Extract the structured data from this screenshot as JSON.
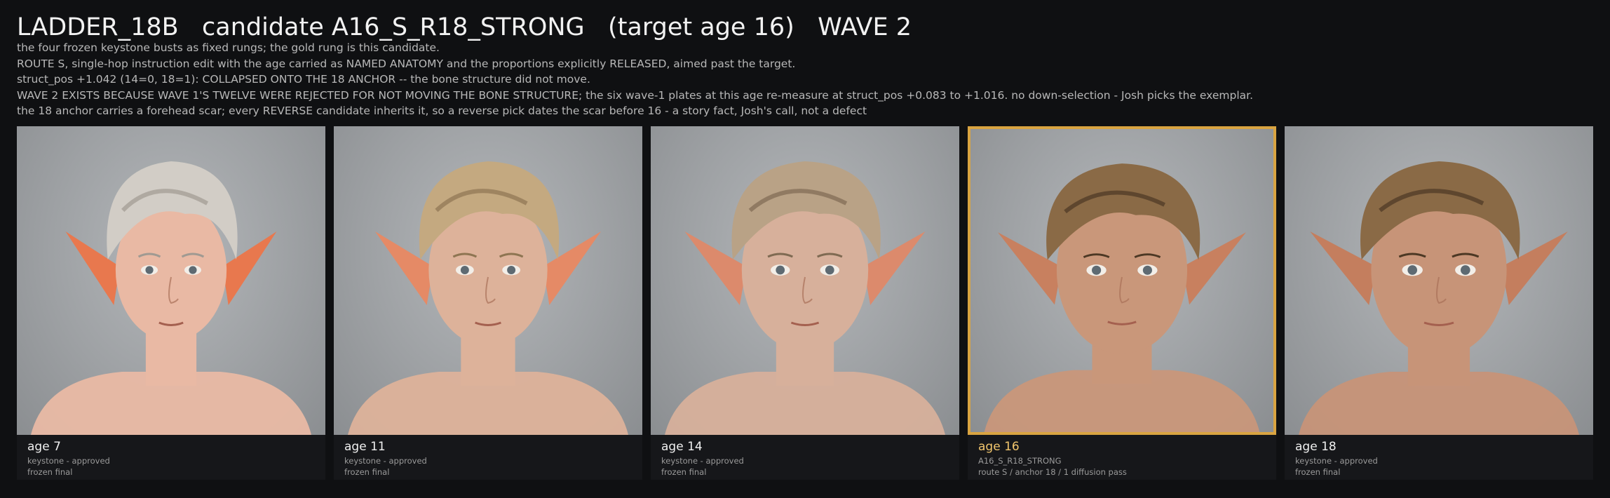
{
  "title": "LADDER_18B   candidate A16_S_R18_STRONG   (target age 16)   WAVE 2",
  "notes": [
    "the four frozen keystone busts as fixed rungs; the gold rung is this candidate.",
    "ROUTE S, single-hop instruction edit with the age carried as NAMED ANATOMY and the proportions explicitly RELEASED, aimed past the target.",
    "struct_pos +1.042 (14=0, 18=1): COLLAPSED ONTO THE 18 ANCHOR -- the bone structure did not move.",
    "WAVE 2 EXISTS BECAUSE WAVE 1'S TWELVE WERE REJECTED FOR NOT MOVING THE BONE STRUCTURE; the six wave-1 plates at this age re-measure at struct_pos +0.083 to +1.016.  no down-selection - Josh picks the exemplar.",
    "the 18 anchor carries a forehead scar; every REVERSE candidate inherits it, so a reverse pick dates the scar before 16 - a story fact, Josh's call, not a defect"
  ],
  "cards": [
    {
      "age": "age 7",
      "line1": "keystone - approved",
      "line2": "frozen final",
      "selected": false,
      "hair": "#d2cdc6",
      "hair_dark": "#a09a92",
      "skin": "#e9b9a4",
      "ear": "#e8784e"
    },
    {
      "age": "age 11",
      "line1": "keystone - approved",
      "line2": "frozen final",
      "selected": false,
      "hair": "#c4a980",
      "hair_dark": "#8e7552",
      "skin": "#ddb29a",
      "ear": "#e58a66"
    },
    {
      "age": "age 14",
      "line1": "keystone - approved",
      "line2": "frozen final",
      "selected": false,
      "hair": "#b9a286",
      "hair_dark": "#7f6a52",
      "skin": "#d7b09b",
      "ear": "#dc8a6c"
    },
    {
      "age": "age 16",
      "line1": "A16_S_R18_STRONG",
      "line2": "route S / anchor 18 / 1 diffusion pass",
      "selected": true,
      "hair": "#8a6a46",
      "hair_dark": "#4c3824",
      "skin": "#c9977a",
      "ear": "#c8805f"
    },
    {
      "age": "age 18",
      "line1": "keystone - approved",
      "line2": "frozen final",
      "selected": false,
      "hair": "#8a6a46",
      "hair_dark": "#4c3824",
      "skin": "#c79478",
      "ear": "#c47e5e"
    }
  ],
  "colors": {
    "background": "#0f1012",
    "selected_border": "#d9a441"
  }
}
